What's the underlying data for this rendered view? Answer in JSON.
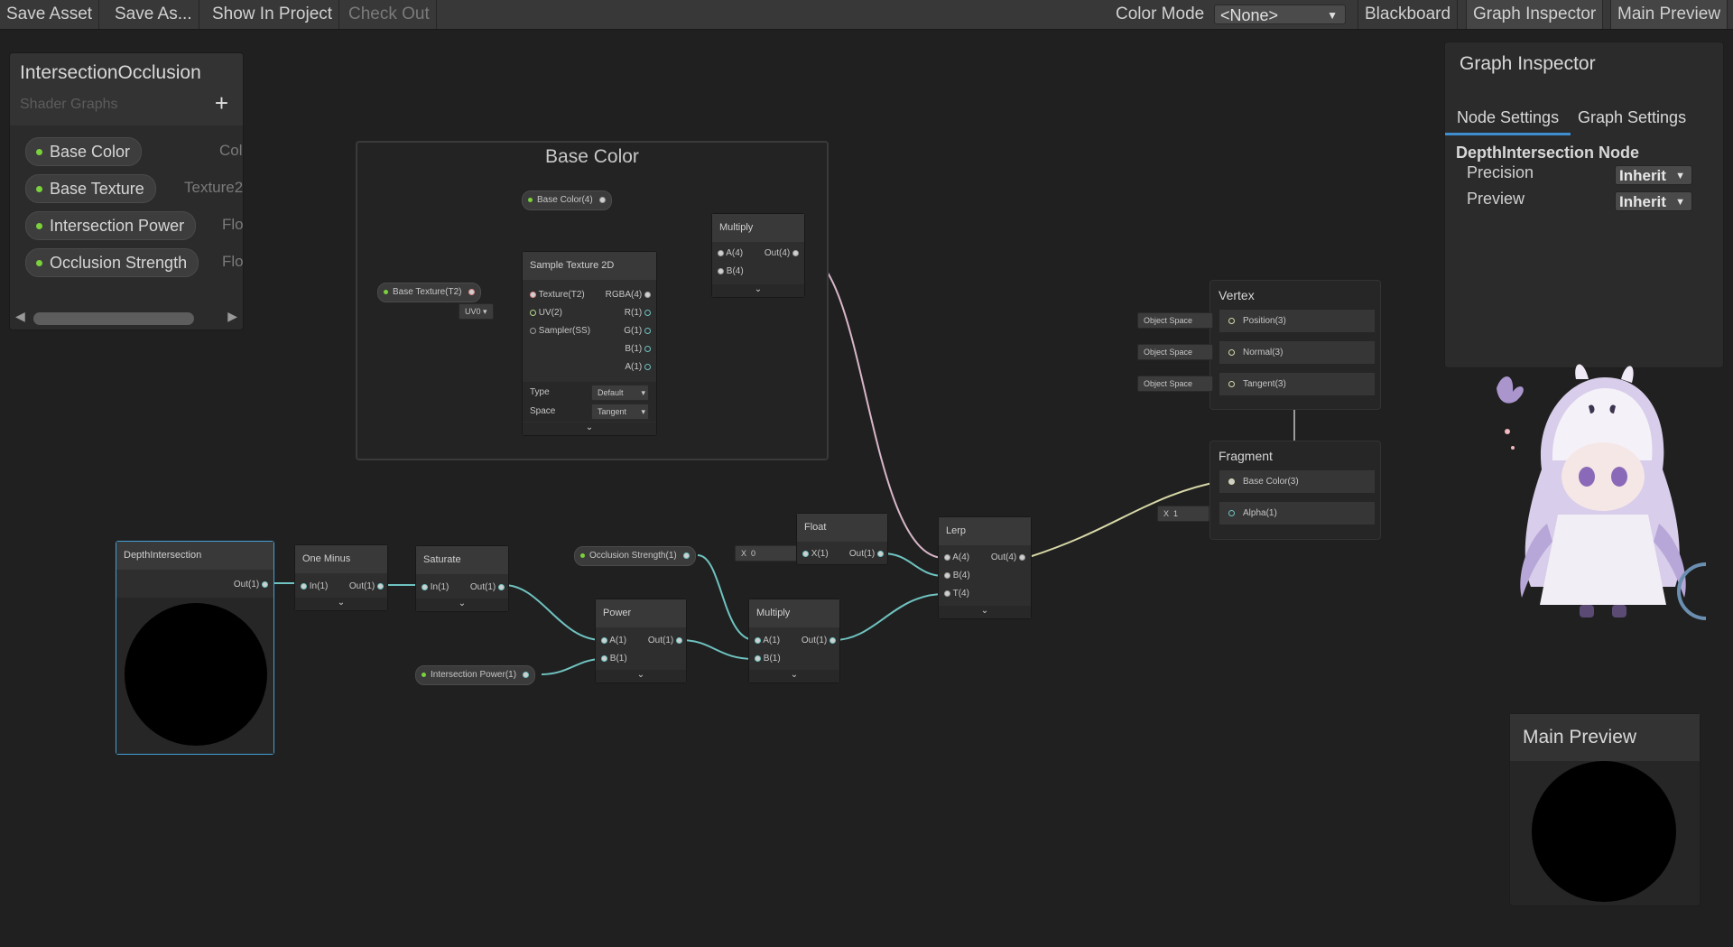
{
  "toolbar": {
    "save_asset": "Save Asset",
    "save_as": "Save As...",
    "show_in_project": "Show In Project",
    "check_out": "Check Out",
    "color_mode_label": "Color Mode",
    "color_mode_value": "<None>",
    "blackboard": "Blackboard",
    "graph_inspector": "Graph Inspector",
    "main_preview": "Main Preview"
  },
  "blackboard": {
    "title": "IntersectionOcclusion",
    "subtitle": "Shader Graphs",
    "add_icon": "+",
    "properties": [
      {
        "name": "Base Color",
        "type": "Col"
      },
      {
        "name": "Base Texture",
        "type": "Texture2"
      },
      {
        "name": "Intersection Power",
        "type": "Flo"
      },
      {
        "name": "Occlusion Strength",
        "type": "Flo"
      }
    ]
  },
  "group": {
    "title": "Base Color"
  },
  "nodes": {
    "base_color_prop": "Base Color(4)",
    "base_texture_prop": "Base Texture(T2)",
    "uv_dropdown": "UV0 ▾",
    "sample_texture": {
      "title": "Sample Texture 2D",
      "inputs": [
        "Texture(T2)",
        "UV(2)",
        "Sampler(SS)"
      ],
      "outputs": [
        "RGBA(4)",
        "R(1)",
        "G(1)",
        "B(1)",
        "A(1)"
      ],
      "type_label": "Type",
      "type_value": "Default",
      "space_label": "Space",
      "space_value": "Tangent"
    },
    "multiply1": {
      "title": "Multiply",
      "inputs": [
        "A(4)",
        "B(4)"
      ],
      "output": "Out(4)"
    },
    "depth_intersection": {
      "title": "DepthIntersection",
      "output": "Out(1)"
    },
    "one_minus": {
      "title": "One Minus",
      "input": "In(1)",
      "output": "Out(1)"
    },
    "saturate": {
      "title": "Saturate",
      "input": "In(1)",
      "output": "Out(1)"
    },
    "occlusion_strength_prop": "Occlusion Strength(1)",
    "intersection_power_prop": "Intersection Power(1)",
    "float_node": {
      "title": "Float",
      "field_label": "X",
      "field_value": "0",
      "input": "X(1)",
      "output": "Out(1)"
    },
    "power": {
      "title": "Power",
      "inputs": [
        "A(1)",
        "B(1)"
      ],
      "output": "Out(1)"
    },
    "multiply2": {
      "title": "Multiply",
      "inputs": [
        "A(1)",
        "B(1)"
      ],
      "output": "Out(1)"
    },
    "lerp": {
      "title": "Lerp",
      "inputs": [
        "A(4)",
        "B(4)",
        "T(4)"
      ],
      "output": "Out(4)"
    }
  },
  "master": {
    "vertex_title": "Vertex",
    "vertex_slots": [
      {
        "space": "Object Space",
        "label": "Position(3)"
      },
      {
        "space": "Object Space",
        "label": "Normal(3)"
      },
      {
        "space": "Object Space",
        "label": "Tangent(3)"
      }
    ],
    "fragment_title": "Fragment",
    "fragment_slots": [
      "Base Color(3)",
      "Alpha(1)"
    ],
    "alpha_field_label": "X",
    "alpha_field_value": "1"
  },
  "inspector": {
    "title": "Graph Inspector",
    "tabs": [
      "Node Settings",
      "Graph Settings"
    ],
    "section": "DepthIntersection Node",
    "precision_label": "Precision",
    "precision_value": "Inherit",
    "preview_label": "Preview",
    "preview_value": "Inherit"
  },
  "main_preview": {
    "title": "Main Preview"
  },
  "colors": {
    "edge_vector": "#d8b6c8",
    "edge_float": "#6fc3c0",
    "edge_vec3": "#d8d8a8",
    "selection": "#44a0d8",
    "property_dot": "#7ad13c"
  }
}
